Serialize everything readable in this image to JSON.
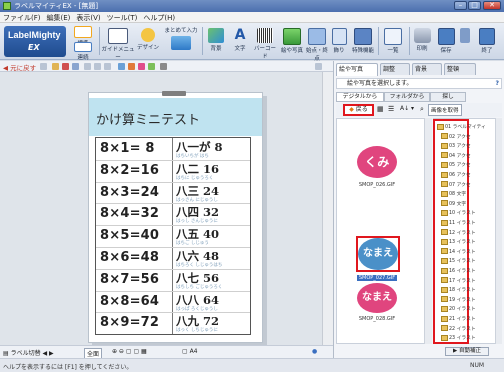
{
  "window": {
    "title": "ラベルマイティEX - [無題]",
    "min": "–",
    "max": "□",
    "close": "✕"
  },
  "menu": [
    "ファイル(F)",
    "編集(E)",
    "表示(V)",
    "ツール(T)",
    "ヘルプ(H)"
  ],
  "logo": {
    "line1": "LabelMighty",
    "line2": "EX"
  },
  "ribbon": {
    "standard": "標準",
    "continuous": "連続",
    "guide_menu": "ガイドメニュー",
    "design": "デザイン",
    "bulk_input": "まとめて入力",
    "background": "背景",
    "text": "文字",
    "barcode": "バーコード",
    "clipart": "絵や写真",
    "start_end": "始点・終点",
    "decoration": "飾り",
    "special": "特殊機能",
    "list": "一覧",
    "print": "印刷",
    "save": "保存",
    "exit": "終了"
  },
  "toolbar": {
    "undo": "元に戻す"
  },
  "page": {
    "title": "かけ算ミニテスト",
    "rows": [
      {
        "eq": "8×1= 8",
        "reading": "八一が 8",
        "small": "はちいちが はち"
      },
      {
        "eq": "8×2=16",
        "reading": "八二 16",
        "small": "はちに じゅうろく"
      },
      {
        "eq": "8×3=24",
        "reading": "八三 24",
        "small": "はっさん にじゅうし"
      },
      {
        "eq": "8×4=32",
        "reading": "八四 32",
        "small": "はっし さんじゅうに"
      },
      {
        "eq": "8×5=40",
        "reading": "八五 40",
        "small": "はちご しじゅう"
      },
      {
        "eq": "8×6=48",
        "reading": "八六 48",
        "small": "はちろく しじゅうはち"
      },
      {
        "eq": "8×7=56",
        "reading": "八七 56",
        "small": "はちしち ごじゅうろく"
      },
      {
        "eq": "8×8=64",
        "reading": "八八 64",
        "small": "はっぱ ろくじゅうし"
      },
      {
        "eq": "8×9=72",
        "reading": "八九 72",
        "small": "はっく しちじゅうに"
      }
    ]
  },
  "status": {
    "label_switch": "ラベル切替",
    "zoom": "全面",
    "page_size": "A4"
  },
  "bottom_status": {
    "message": "ヘルプを表示するには [F1] を押してください。",
    "right": "NUM"
  },
  "panel": {
    "tabs": [
      "絵や写真",
      "調整",
      "背景",
      "整頓"
    ],
    "message": "絵や写真を選択します。",
    "subtabs": [
      "デジタルから",
      "フォルダから",
      "探し"
    ],
    "back": "戻る",
    "search_btn": "画像を取得",
    "thumbs": [
      {
        "text": "くみ",
        "caption": "SMOP_026.GIF",
        "color": "#e0457e"
      },
      {
        "text": "なまえ",
        "caption": "SMOP_027.GIF",
        "color": "#4a90c8"
      },
      {
        "text": "なまえ",
        "caption": "SMOP_028.GIF",
        "color": "#e0457e"
      }
    ],
    "tree": [
      "01 ラベルマイティ",
      "02 アクセ",
      "03 アクセ",
      "04 アクセ",
      "05 アクセ",
      "06 アクセ",
      "07 アクセ",
      "08 文字",
      "09 文字",
      "10 イラスト",
      "11 イラスト",
      "12 イラスト",
      "13 イラスト",
      "14 イラスト",
      "15 イラスト",
      "16 イラスト",
      "17 イラスト",
      "18 イラスト",
      "19 イラスト",
      "20 イラスト",
      "21 イラスト",
      "22 イラスト",
      "23 イラスト"
    ],
    "auto_btn": "自動補正"
  }
}
